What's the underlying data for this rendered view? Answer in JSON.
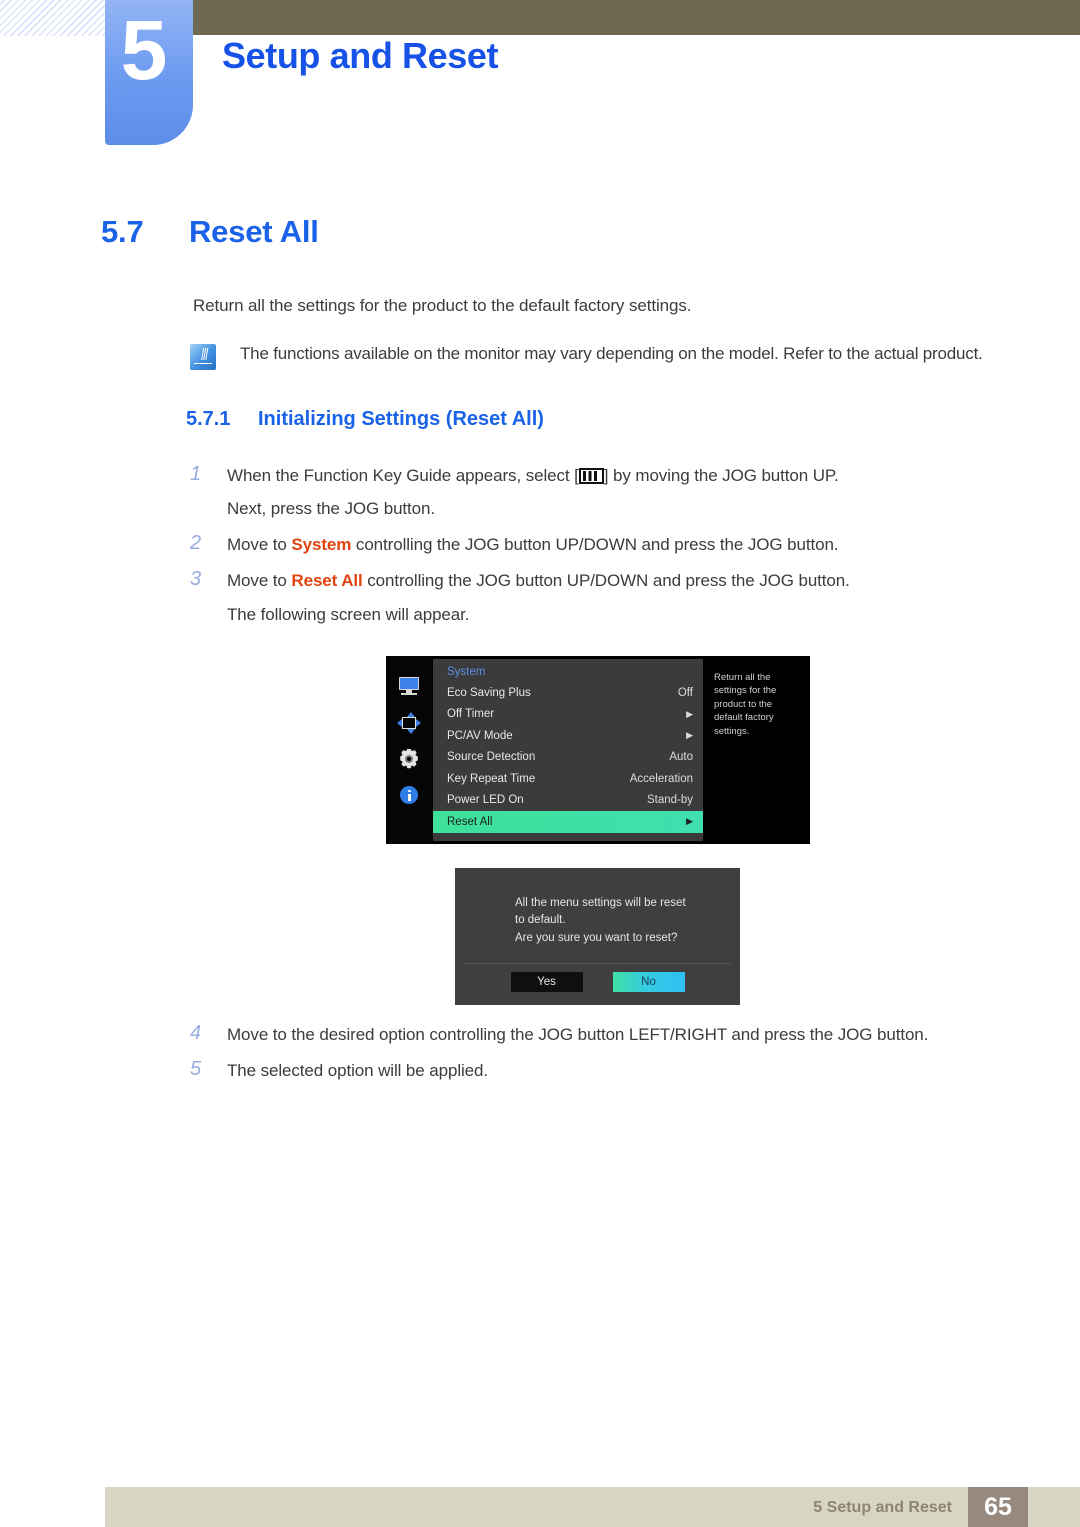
{
  "header": {
    "chapter_number": "5",
    "chapter_title": "Setup and Reset"
  },
  "section": {
    "number": "5.7",
    "title": "Reset All",
    "intro": "Return all the settings for the product to the default factory settings.",
    "note": "The functions available on the monitor may vary depending on the model. Refer to the actual product.",
    "sub_number": "5.7.1",
    "sub_title": "Initializing Settings (Reset All)"
  },
  "steps_top": [
    {
      "num": "1",
      "pre": "When the Function Key Guide appears, select [",
      "post": "] by moving the JOG button UP.",
      "sub": "Next, press the JOG button."
    },
    {
      "num": "2",
      "pre": "Move to ",
      "highlight": "System",
      "post": " controlling the JOG button UP/DOWN and press the JOG button.",
      "sub": ""
    },
    {
      "num": "3",
      "pre": "Move to ",
      "highlight": "Reset All",
      "post": " controlling the JOG button UP/DOWN and press the JOG button.",
      "sub": "The following screen will appear."
    }
  ],
  "steps_bottom": [
    {
      "num": "4",
      "text": "Move to the desired option controlling the JOG button LEFT/RIGHT and press the JOG button."
    },
    {
      "num": "5",
      "text": "The selected option will be applied."
    }
  ],
  "osd": {
    "menu_title": "System",
    "rail_icons": [
      "monitor-icon",
      "picture-size-icon",
      "system-gear-icon",
      "information-icon"
    ],
    "rows": [
      {
        "label": "Eco Saving Plus",
        "value": "Off",
        "arrow": false,
        "selected": false
      },
      {
        "label": "Off Timer",
        "value": "",
        "arrow": true,
        "selected": false
      },
      {
        "label": "PC/AV Mode",
        "value": "",
        "arrow": true,
        "selected": false
      },
      {
        "label": "Source Detection",
        "value": "Auto",
        "arrow": false,
        "selected": false
      },
      {
        "label": "Key Repeat Time",
        "value": "Acceleration",
        "arrow": false,
        "selected": false
      },
      {
        "label": "Power LED On",
        "value": "Stand-by",
        "arrow": false,
        "selected": false
      },
      {
        "label": "Reset All",
        "value": "",
        "arrow": true,
        "selected": true
      }
    ],
    "description": "Return all the settings for the product to the default factory settings."
  },
  "dialog": {
    "line1": "All the menu settings will be reset",
    "line2": "to default.",
    "line3": "Are you sure you want to reset?",
    "yes_label": "Yes",
    "no_label": "No"
  },
  "footer": {
    "text": "5 Setup and Reset",
    "page": "65"
  },
  "colors": {
    "accent_blue": "#1651e8",
    "highlight_orange": "#e0430d",
    "osd_selected_green": "#3fe09a",
    "olive_bar": "#6e6a52",
    "footer_bar": "#d9d5c3",
    "footer_page_box": "#97897e"
  }
}
